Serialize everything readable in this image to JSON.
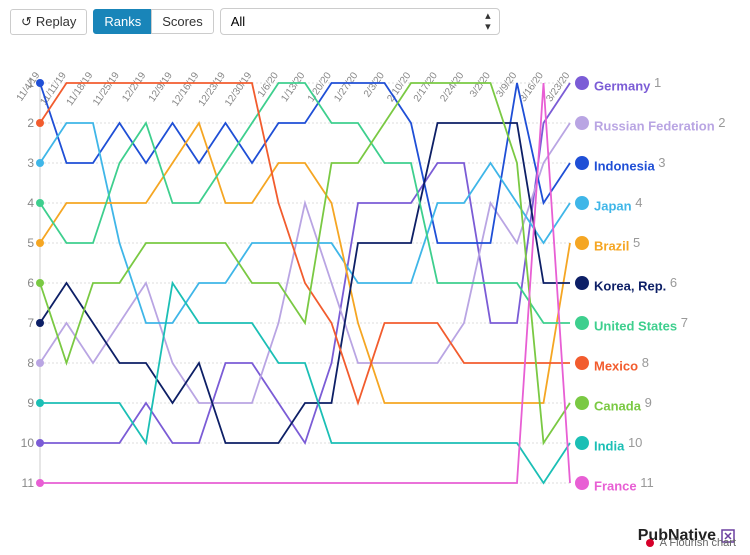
{
  "toolbar": {
    "replay_label": "Replay",
    "ranks_label": "Ranks",
    "scores_label": "Scores",
    "filter_value": "All"
  },
  "footer": {
    "brand": "PubNative",
    "credit": "A Flourish chart"
  },
  "chart_data": {
    "type": "line",
    "title": "",
    "xlabel": "",
    "ylabel": "",
    "ylim": [
      1,
      11
    ],
    "y_inverted": true,
    "categories": [
      "11/4/19",
      "11/11/19",
      "11/18/19",
      "11/25/19",
      "12/2/19",
      "12/9/19",
      "12/16/19",
      "12/23/19",
      "12/30/19",
      "1/6/20",
      "1/13/20",
      "1/20/20",
      "1/27/20",
      "2/3/20",
      "2/10/20",
      "2/17/20",
      "2/24/20",
      "3/2/20",
      "3/9/20",
      "3/16/20",
      "3/23/20"
    ],
    "series": [
      {
        "name": "Germany",
        "final_rank": 1,
        "color": "#7b5cd6",
        "values": [
          10,
          10,
          10,
          10,
          9,
          10,
          10,
          8,
          8,
          9,
          10,
          8,
          4,
          4,
          4,
          3,
          3,
          7,
          7,
          2,
          1
        ]
      },
      {
        "name": "Russian Federation",
        "final_rank": 2,
        "color": "#b9a5e3",
        "values": [
          8,
          7,
          8,
          7,
          6,
          8,
          9,
          9,
          9,
          7,
          4,
          6,
          8,
          8,
          8,
          8,
          7,
          4,
          5,
          3,
          2
        ]
      },
      {
        "name": "Indonesia",
        "final_rank": 3,
        "color": "#1f4fd6",
        "values": [
          1,
          3,
          3,
          2,
          3,
          2,
          3,
          2,
          3,
          2,
          2,
          1,
          1,
          1,
          2,
          5,
          5,
          5,
          1,
          4,
          3
        ]
      },
      {
        "name": "Japan",
        "final_rank": 4,
        "color": "#3fb6e8",
        "values": [
          3,
          2,
          2,
          5,
          7,
          7,
          6,
          6,
          5,
          5,
          5,
          5,
          6,
          6,
          6,
          4,
          4,
          3,
          4,
          5,
          4
        ]
      },
      {
        "name": "Brazil",
        "final_rank": 5,
        "color": "#f5a623",
        "values": [
          5,
          4,
          4,
          4,
          4,
          3,
          2,
          4,
          4,
          3,
          3,
          4,
          7,
          9,
          9,
          9,
          9,
          9,
          9,
          9,
          5
        ]
      },
      {
        "name": "Korea, Rep.",
        "final_rank": 6,
        "color": "#0d1f66",
        "values": [
          7,
          6,
          7,
          8,
          8,
          9,
          8,
          10,
          10,
          10,
          9,
          9,
          5,
          5,
          5,
          2,
          2,
          2,
          2,
          6,
          6
        ]
      },
      {
        "name": "United States",
        "final_rank": 7,
        "color": "#3ecf8e",
        "values": [
          4,
          5,
          5,
          3,
          2,
          4,
          4,
          3,
          2,
          1,
          1,
          2,
          2,
          3,
          3,
          6,
          6,
          6,
          6,
          7,
          7
        ]
      },
      {
        "name": "Mexico",
        "final_rank": 8,
        "color": "#f25c2e",
        "values": [
          2,
          1,
          1,
          1,
          1,
          1,
          1,
          1,
          1,
          4,
          6,
          7,
          9,
          7,
          7,
          7,
          8,
          8,
          8,
          8,
          8
        ]
      },
      {
        "name": "Canada",
        "final_rank": 9,
        "color": "#7ac943",
        "values": [
          6,
          8,
          6,
          6,
          5,
          5,
          5,
          5,
          6,
          6,
          7,
          3,
          3,
          2,
          1,
          1,
          1,
          1,
          3,
          10,
          9
        ]
      },
      {
        "name": "India",
        "final_rank": 10,
        "color": "#1bbfb5",
        "values": [
          9,
          9,
          9,
          9,
          10,
          6,
          7,
          7,
          7,
          8,
          8,
          10,
          10,
          10,
          10,
          10,
          10,
          10,
          10,
          11,
          10
        ]
      },
      {
        "name": "France",
        "final_rank": 11,
        "color": "#e85fd4",
        "values": [
          11,
          11,
          11,
          11,
          11,
          11,
          11,
          11,
          11,
          11,
          11,
          11,
          11,
          11,
          11,
          11,
          11,
          11,
          11,
          1,
          11
        ]
      }
    ]
  }
}
